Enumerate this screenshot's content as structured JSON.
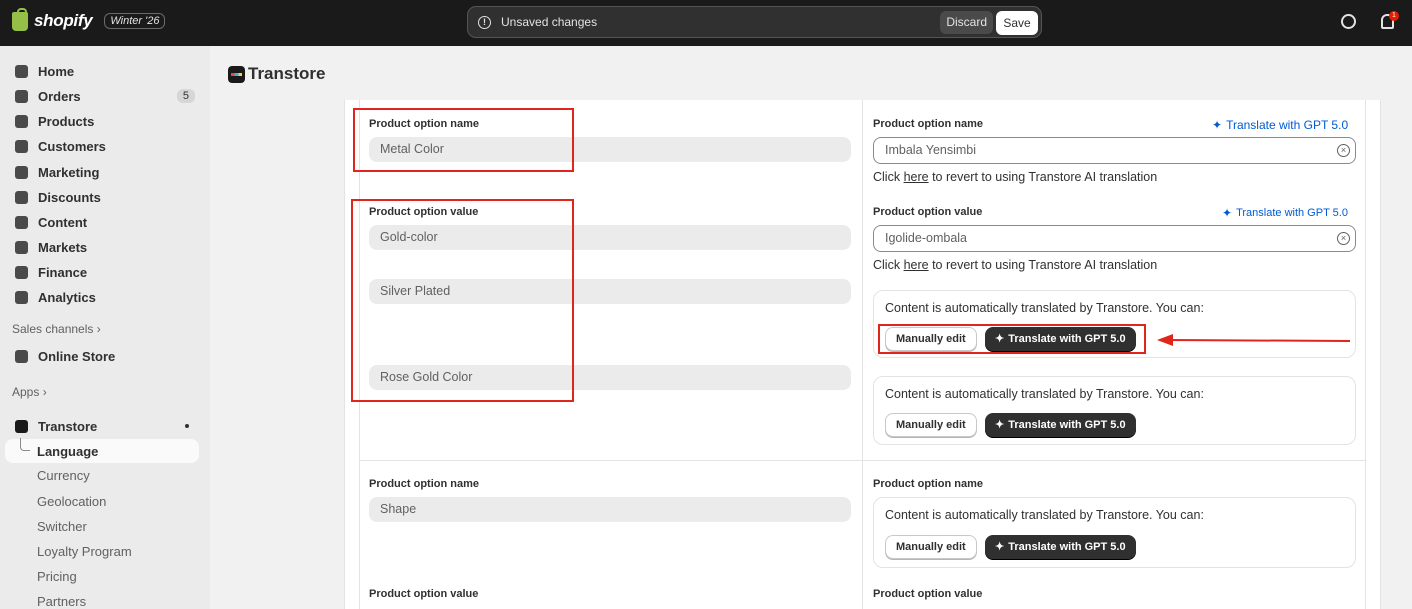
{
  "topbar": {
    "brand": "shopify",
    "season": "Winter '26",
    "unsaved_text": "Unsaved changes",
    "discard_label": "Discard",
    "save_label": "Save",
    "notification_count": "1"
  },
  "sidebar": {
    "items": [
      {
        "label": "Home",
        "icon": "home-icon"
      },
      {
        "label": "Orders",
        "icon": "inbox-icon",
        "badge": "5"
      },
      {
        "label": "Products",
        "icon": "tag-icon"
      },
      {
        "label": "Customers",
        "icon": "person-icon"
      },
      {
        "label": "Marketing",
        "icon": "target-icon"
      },
      {
        "label": "Discounts",
        "icon": "discount-icon"
      },
      {
        "label": "Content",
        "icon": "content-icon"
      },
      {
        "label": "Markets",
        "icon": "globe-icon"
      },
      {
        "label": "Finance",
        "icon": "bank-icon"
      },
      {
        "label": "Analytics",
        "icon": "chart-icon"
      }
    ],
    "sales_channels_label": "Sales channels",
    "online_store_label": "Online Store",
    "apps_label": "Apps",
    "app_name": "Transtore",
    "app_subitems": [
      "Language",
      "Currency",
      "Geolocation",
      "Switcher",
      "Loyalty Program",
      "Pricing",
      "Partners"
    ]
  },
  "app_header": {
    "title": "Transtore"
  },
  "sections": {
    "option1": {
      "name_label": "Product option name",
      "name_value": "Metal Color",
      "translated_name_label": "Product option name",
      "translated_name_value": "Imbala Yensimbi",
      "value_label": "Product option value",
      "values": [
        "Gold-color",
        "Silver Plated",
        "Rose Gold Color"
      ],
      "translated_value_label": "Product option value",
      "translated_value": "Igolide-ombala"
    },
    "option2": {
      "name_label": "Product option name",
      "name_value": "Shape",
      "translated_name_label": "Product option name",
      "value_label": "Product option value",
      "translated_value_label": "Product option value"
    }
  },
  "common": {
    "translate_gpt": "Translate with GPT 5.0",
    "revert_prefix": "Click ",
    "revert_here": "here",
    "revert_suffix": " to revert to using Transtore AI translation",
    "auto_text": "Content is automatically translated by Transtore. You can:",
    "manually_edit": "Manually edit"
  },
  "colors": {
    "accent": "#005bd3",
    "annotation": "#e0261a",
    "topbar": "#1a1a1a"
  }
}
